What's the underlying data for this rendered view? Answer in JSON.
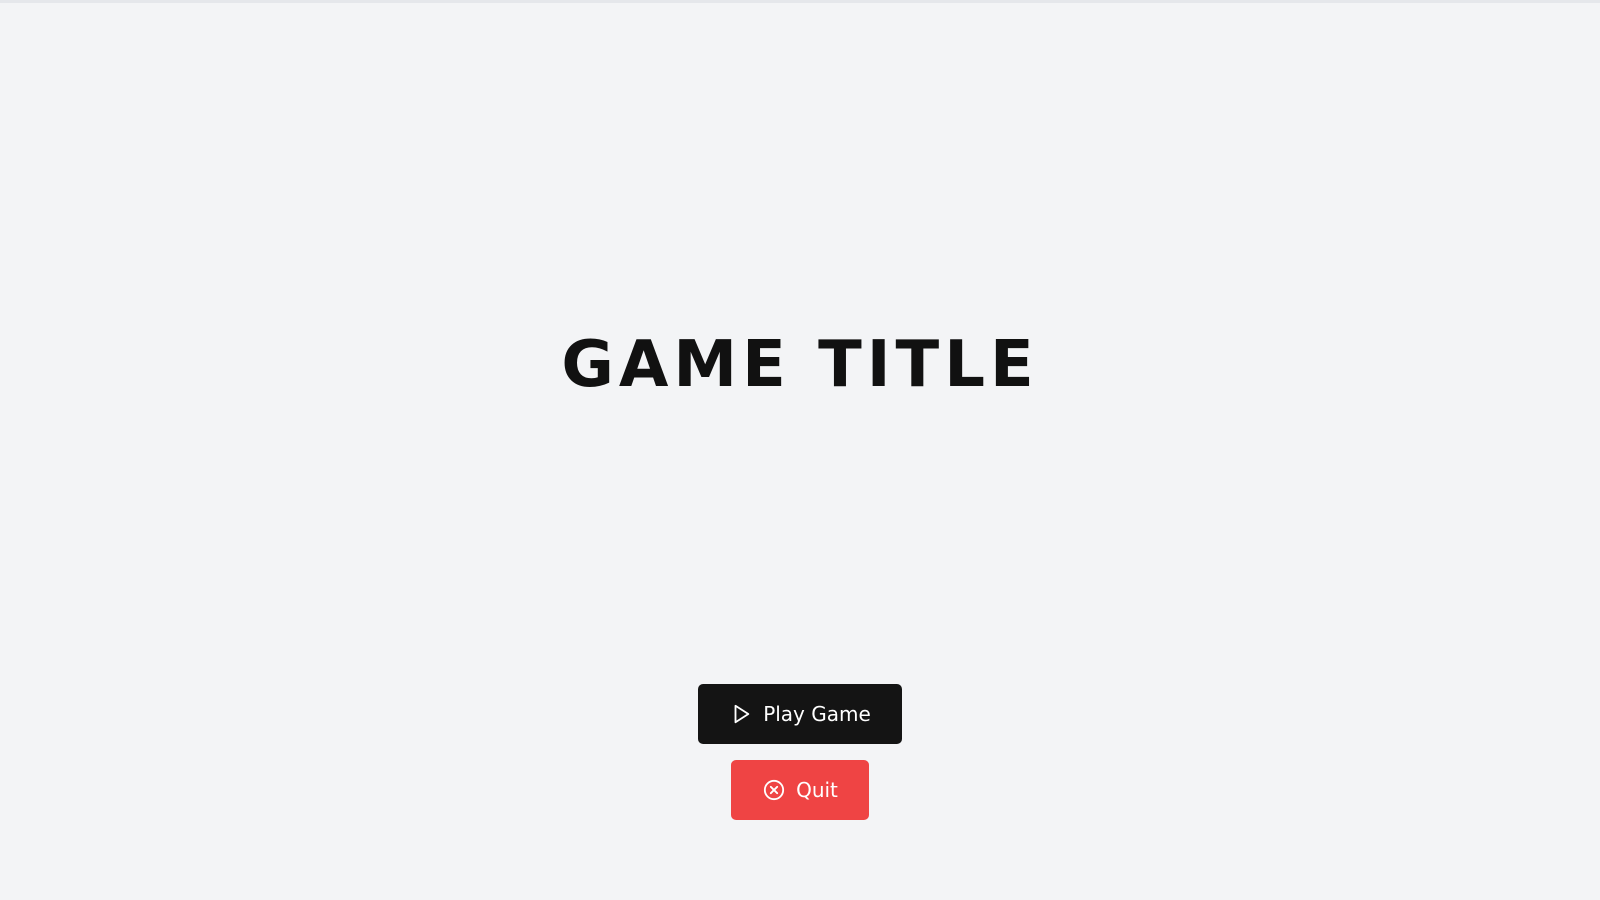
{
  "game": {
    "title": "GAME TITLE"
  },
  "menu": {
    "play": {
      "label": "Play Game",
      "icon": "play-icon",
      "color": "#141414"
    },
    "quit": {
      "label": "Quit",
      "icon": "close-circle-icon",
      "color": "#ef4444"
    }
  },
  "colors": {
    "background": "#f3f4f6",
    "title": "#111111"
  }
}
